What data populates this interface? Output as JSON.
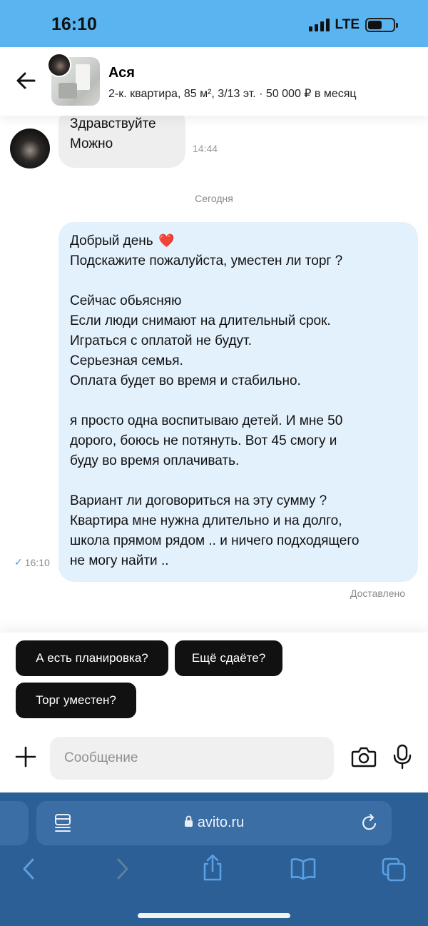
{
  "status_bar": {
    "time": "16:10",
    "network": "LTE"
  },
  "header": {
    "name": "Ася",
    "listing": "2-к. квартира, 85 м², 3/13 эт. · 50 000 ₽ в месяц"
  },
  "chat": {
    "incoming": {
      "lines": [
        "Здравствуйте",
        " Можно"
      ],
      "time": "14:44"
    },
    "date_separator": "Сегодня",
    "outgoing": {
      "lines": [
        "Добрый день",
        "Подскажите пожалуйста, уместен ли торг ?",
        "",
        "Сейчас обьясняю",
        "Если люди снимают на длительный срок.",
        "Играться с оплатой не будут.",
        "Серьезная семья.",
        "Оплата будет во время и стабильно.",
        "",
        " я просто одна воспитываю детей. И мне 50",
        "дорого, боюсь не потянуть. Вот 45 смогу и",
        "буду во время оплачивать.",
        "",
        "Вариант ли договориться на эту сумму ?",
        "Квартира мне нужна длительно и на долго,",
        "школа прямом рядом .. и ничего подходящего",
        "не могу найти .."
      ],
      "heart": "❤️",
      "time": "16:10",
      "status": "Доставлено"
    }
  },
  "quick_replies": [
    "А есть планировка?",
    "Ещё сдаёте?",
    "Торг уместен?"
  ],
  "composer": {
    "placeholder": "Сообщение"
  },
  "browser": {
    "url": "avito.ru"
  },
  "colors": {
    "status_bar": "#5ab4f0",
    "outgoing_bubble": "#e3f1fd",
    "incoming_bubble": "#eeeeef",
    "chip": "#111111",
    "safari_bar": "#2b5f95"
  }
}
